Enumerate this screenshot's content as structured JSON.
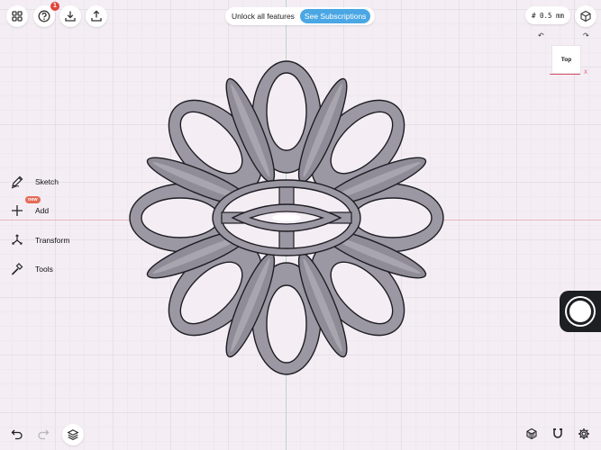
{
  "toolbar": {
    "notification_count": "1",
    "unlock_text": "Unlock all features",
    "subscriptions_label": "See Subscriptions",
    "grid_size": "# 0.5 mm"
  },
  "viewcube": {
    "face": "Top",
    "axis_x_label": "X"
  },
  "tools": [
    {
      "label": "Sketch",
      "icon": "pencil-icon"
    },
    {
      "label": "Add",
      "icon": "plus-icon",
      "badge": "new"
    },
    {
      "label": "Transform",
      "icon": "transform-icon"
    },
    {
      "label": "Tools",
      "icon": "hammer-icon"
    }
  ],
  "colors": {
    "accent": "#4aa7e4",
    "badge": "#e0453a",
    "model_fill": "#9b98a3",
    "model_stroke": "#1e1e24"
  }
}
